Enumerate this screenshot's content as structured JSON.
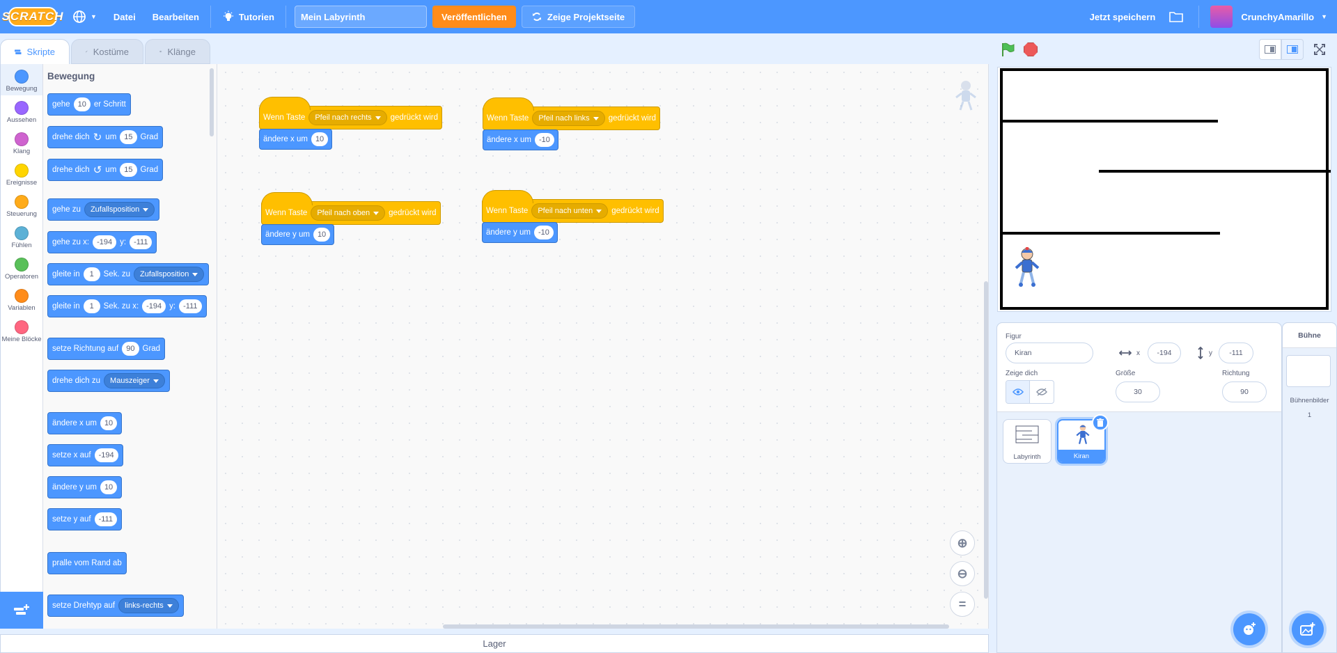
{
  "menubar": {
    "logo": "SCRATCH",
    "file": "Datei",
    "edit": "Bearbeiten",
    "tutorials": "Tutorien",
    "project_title": "Mein Labyrinth",
    "share": "Veröffentlichen",
    "see_project": "Zeige Projektseite",
    "save_now": "Jetzt speichern",
    "username": "CrunchyAmarillo"
  },
  "tabs": {
    "code": "Skripte",
    "costumes": "Kostüme",
    "sounds": "Klänge"
  },
  "categories": [
    {
      "label": "Bewegung",
      "color": "#4c97ff"
    },
    {
      "label": "Aussehen",
      "color": "#9966ff"
    },
    {
      "label": "Klang",
      "color": "#cf63cf"
    },
    {
      "label": "Ereignisse",
      "color": "#ffd500"
    },
    {
      "label": "Steuerung",
      "color": "#ffab19"
    },
    {
      "label": "Fühlen",
      "color": "#5cb1d6"
    },
    {
      "label": "Operatoren",
      "color": "#59c059"
    },
    {
      "label": "Variablen",
      "color": "#ff8c1a"
    },
    {
      "label": "Meine Blöcke",
      "color": "#ff6680"
    }
  ],
  "flyout": {
    "title": "Bewegung",
    "move": {
      "a": "gehe",
      "n": "10",
      "b": "er Schritt"
    },
    "turn_right": {
      "a": "drehe dich",
      "b": "um",
      "n": "15",
      "c": "Grad"
    },
    "turn_left": {
      "a": "drehe dich",
      "b": "um",
      "n": "15",
      "c": "Grad"
    },
    "goto": {
      "a": "gehe zu",
      "dd": "Zufallsposition"
    },
    "goto_xy": {
      "a": "gehe zu x:",
      "x": "-194",
      "b": "y:",
      "y": "-111"
    },
    "glide": {
      "a": "gleite in",
      "n": "1",
      "b": "Sek. zu",
      "dd": "Zufallsposition"
    },
    "glide_xy": {
      "a": "gleite in",
      "n": "1",
      "b": "Sek. zu x:",
      "x": "-194",
      "c": "y:",
      "y": "-111"
    },
    "point_dir": {
      "a": "setze Richtung auf",
      "n": "90",
      "b": "Grad"
    },
    "point_towards": {
      "a": "drehe dich zu",
      "dd": "Mauszeiger"
    },
    "change_x": {
      "a": "ändere x um",
      "n": "10"
    },
    "set_x": {
      "a": "setze x auf",
      "n": "-194"
    },
    "change_y": {
      "a": "ändere y um",
      "n": "10"
    },
    "set_y": {
      "a": "setze y auf",
      "n": "-111"
    },
    "bounce": "pralle vom Rand ab",
    "rotation_style": {
      "a": "setze Drehtyp auf",
      "dd": "links-rechts"
    }
  },
  "scripts": [
    {
      "hat_a": "Wenn Taste",
      "key": "Pfeil nach rechts",
      "hat_b": "gedrückt wird",
      "cmd": "ändere x um",
      "val": "10"
    },
    {
      "hat_a": "Wenn Taste",
      "key": "Pfeil nach links",
      "hat_b": "gedrückt wird",
      "cmd": "ändere x um",
      "val": "-10"
    },
    {
      "hat_a": "Wenn Taste",
      "key": "Pfeil nach oben",
      "hat_b": "gedrückt wird",
      "cmd": "ändere y um",
      "val": "10"
    },
    {
      "hat_a": "Wenn Taste",
      "key": "Pfeil nach unten",
      "hat_b": "gedrückt wird",
      "cmd": "ändere y um",
      "val": "-10"
    }
  ],
  "backpack": "Lager",
  "sprite_info": {
    "sprite_label": "Figur",
    "sprite_name": "Kiran",
    "x_label": "x",
    "x": "-194",
    "y_label": "y",
    "y": "-111",
    "show_label": "Zeige dich",
    "size_label": "Größe",
    "size": "30",
    "direction_label": "Richtung",
    "direction": "90"
  },
  "sprites": [
    {
      "name": "Labyrinth"
    },
    {
      "name": "Kiran"
    }
  ],
  "stage_pane": {
    "title": "Bühne",
    "backdrops_label": "Bühnenbilder",
    "backdrops_count": "1"
  }
}
